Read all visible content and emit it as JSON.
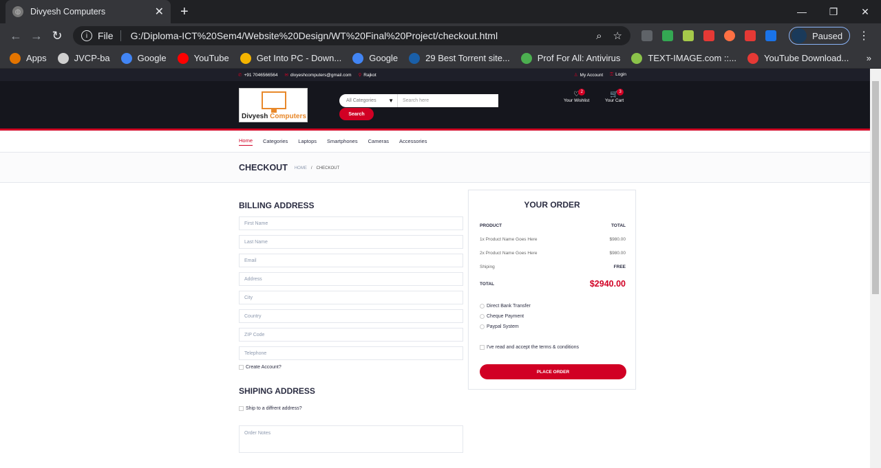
{
  "browser": {
    "tab_title": "Divyesh Computers",
    "omnibox_scheme": "File",
    "url": "G:/Diploma-ICT%20Sem4/Website%20Design/WT%20Final%20Project/checkout.html",
    "profile_status": "Paused",
    "bookmarks": [
      {
        "label": "Apps",
        "icon": "apps-icon",
        "color": "#e37400"
      },
      {
        "label": "JVCP-ba",
        "icon": "globe-icon",
        "color": "#cfcfcf"
      },
      {
        "label": "Google",
        "icon": "google-icon",
        "color": "#4285f4"
      },
      {
        "label": "YouTube",
        "icon": "youtube-icon",
        "color": "#ff0000"
      },
      {
        "label": "Get Into PC - Down...",
        "icon": "g-icon",
        "color": "#f4b400"
      },
      {
        "label": "Google",
        "icon": "google-icon",
        "color": "#4285f4"
      },
      {
        "label": "29 Best Torrent site...",
        "icon": "torrent-icon",
        "color": "#1a5fa8"
      },
      {
        "label": "Prof For All: Antivirus",
        "icon": "p-icon",
        "color": "#4caf50"
      },
      {
        "label": "TEXT-IMAGE.com ::...",
        "icon": "textimage-icon",
        "color": "#8bc34a"
      },
      {
        "label": "YouTube Download...",
        "icon": "refresh-icon",
        "color": "#e53935"
      }
    ]
  },
  "site": {
    "top_header": {
      "phone": "+91 7046566564",
      "email": "divyeshcomputers@gmail.com",
      "location": "Rajkot",
      "account": "My Account",
      "login": "Login"
    },
    "logo": {
      "text_a": "Divyesh",
      "text_b": "Computers"
    },
    "search": {
      "category": "All Categories",
      "placeholder": "Search here",
      "button": "Search"
    },
    "wishlist": {
      "label": "Your Wishlist",
      "count": "2"
    },
    "cart": {
      "label": "Your Cart",
      "count": "3"
    },
    "nav": [
      "Home",
      "Categories",
      "Laptops",
      "Smartphones",
      "Cameras",
      "Accessories"
    ],
    "breadcrumb": {
      "title": "CHECKOUT",
      "home": "HOME",
      "sep": "/",
      "current": "CHECKOUT"
    },
    "billing": {
      "title": "BILLING ADDRESS",
      "fields": [
        "First Name",
        "Last Name",
        "Email",
        "Address",
        "City",
        "Country",
        "ZIP Code",
        "Telephone"
      ],
      "create_account": "Create Account?"
    },
    "shipping": {
      "title": "SHIPING ADDRESS",
      "ship_diff": "Ship to a diffrent address?",
      "notes_placeholder": "Order Notes"
    },
    "order": {
      "title": "YOUR ORDER",
      "col_product": "PRODUCT",
      "col_total": "TOTAL",
      "items": [
        {
          "name": "1x Product Name Goes Here",
          "price": "$980.00"
        },
        {
          "name": "2x Product Name Goes Here",
          "price": "$980.00"
        }
      ],
      "shipping_label": "Shiping",
      "shipping_value": "FREE",
      "total_label": "TOTAL",
      "total_value": "$2940.00",
      "payments": [
        "Direct Bank Transfer",
        "Cheque Payment",
        "Paypal System"
      ],
      "terms": "I've read and accept the terms & conditions",
      "place_order": "PLACE ORDER"
    },
    "colors": {
      "accent": "#d10024",
      "header_bg": "#15161d",
      "top_header_bg": "#1e1f29"
    }
  }
}
